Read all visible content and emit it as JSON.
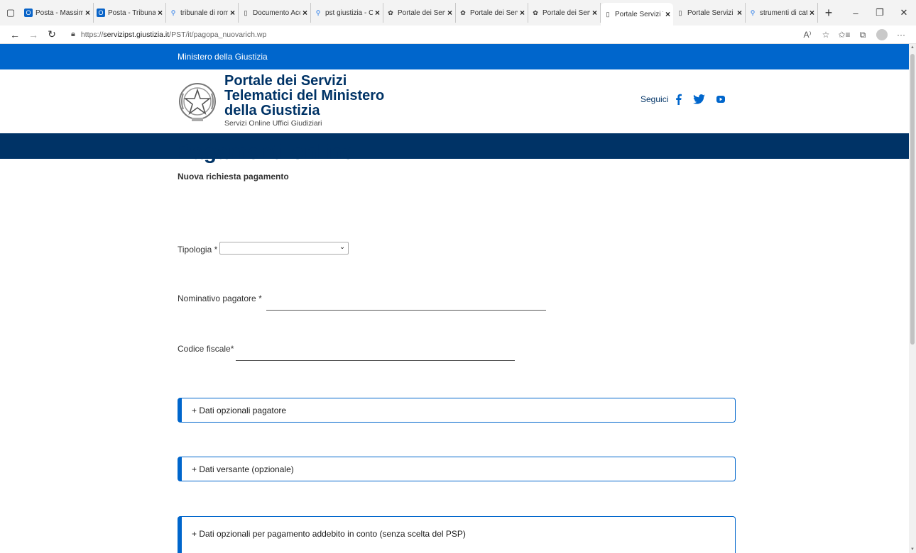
{
  "browser": {
    "tabs": [
      {
        "label": "Posta - Massimo",
        "icon": "outlook-icon",
        "active": false
      },
      {
        "label": "Posta - Tribunale",
        "icon": "outlook-icon",
        "active": false
      },
      {
        "label": "tribunale di roma",
        "icon": "search-icon",
        "active": false
      },
      {
        "label": "Documento Accessibile",
        "icon": "document-icon",
        "active": false
      },
      {
        "label": "pst giustizia - Cerca",
        "icon": "search-icon",
        "active": false
      },
      {
        "label": "Portale dei Servizi",
        "icon": "emblem-icon",
        "active": false
      },
      {
        "label": "Portale dei Servizi",
        "icon": "emblem-icon",
        "active": false
      },
      {
        "label": "Portale dei Servizi",
        "icon": "emblem-icon",
        "active": false
      },
      {
        "label": "Portale Servizi Telematici",
        "icon": "document-icon",
        "active": true
      },
      {
        "label": "Portale Servizi Telematici",
        "icon": "document-icon",
        "active": false
      },
      {
        "label": "strumenti di catalogazione",
        "icon": "search-icon",
        "active": false
      }
    ],
    "url_prefix": "https://",
    "url_host": "servizipst.giustizia.it",
    "url_path": "/PST/it/pagopa_nuovarich.wp"
  },
  "page": {
    "topbar_label": "Ministero della Giustizia",
    "brand_title": "Portale dei Servizi Telematici del Ministero della Giustizia",
    "brand_subtitle": "Servizi Online Uffici Giudiziari",
    "social_label": "Seguici",
    "title": "Pagamenti online",
    "subtitle": "Nuova richiesta pagamento",
    "form": {
      "tipologia_label": "Tipologia *",
      "tipologia_value": "",
      "nominativo_label": "Nominativo pagatore *",
      "nominativo_value": "",
      "codice_fiscale_label": "Codice fiscale*",
      "codice_fiscale_value": ""
    },
    "accordions": [
      "+ Dati opzionali pagatore",
      "+ Dati versante (opzionale)",
      "+ Dati opzionali per pagamento addebito in conto (senza scelta del PSP)"
    ]
  },
  "colors": {
    "primary_blue": "#0066cc",
    "dark_blue": "#003366"
  }
}
